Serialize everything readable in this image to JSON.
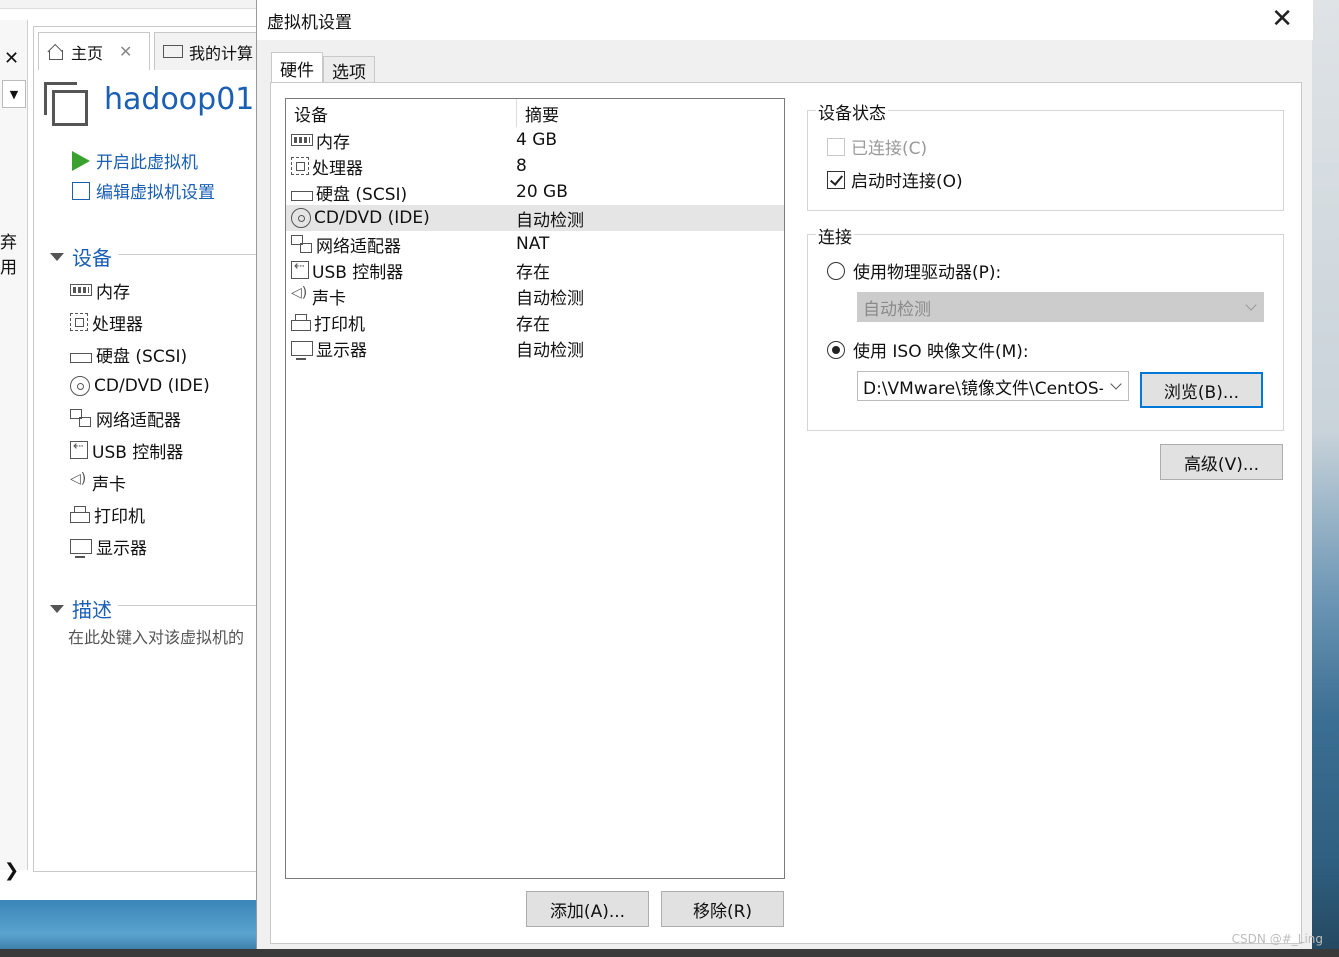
{
  "background_app": {
    "tabs": [
      {
        "label": "主页",
        "icon": "home-icon"
      },
      {
        "label": "我的计算",
        "icon": "computer-icon"
      }
    ],
    "vm_name": "hadoop01",
    "actions": {
      "power_on": "开启此虚拟机",
      "edit_settings": "编辑虚拟机设置"
    },
    "devices_section": "设备",
    "devices": [
      "内存",
      "处理器",
      "硬盘 (SCSI)",
      "CD/DVD (IDE)",
      "网络适配器",
      "USB 控制器",
      "声卡",
      "打印机",
      "显示器"
    ],
    "description_section": "描述",
    "description_placeholder": "在此处键入对该虚拟机的",
    "side_text": "弃用",
    "close_glyph": "✕",
    "chevron_glyph": "❯"
  },
  "dialog": {
    "title": "虚拟机设置",
    "close_glyph": "✕",
    "tabs": [
      {
        "label": "硬件",
        "active": true
      },
      {
        "label": "选项",
        "active": false
      }
    ],
    "device_table": {
      "headers": [
        "设备",
        "摘要"
      ],
      "rows": [
        {
          "device": "内存",
          "summary": "4 GB",
          "icon": "memory-icon"
        },
        {
          "device": "处理器",
          "summary": "8",
          "icon": "processor-icon"
        },
        {
          "device": "硬盘 (SCSI)",
          "summary": "20 GB",
          "icon": "hard-disk-icon"
        },
        {
          "device": "CD/DVD (IDE)",
          "summary": "自动检测",
          "icon": "cd-dvd-icon",
          "selected": true
        },
        {
          "device": "网络适配器",
          "summary": "NAT",
          "icon": "network-adapter-icon"
        },
        {
          "device": "USB 控制器",
          "summary": "存在",
          "icon": "usb-icon"
        },
        {
          "device": "声卡",
          "summary": "自动检测",
          "icon": "sound-card-icon"
        },
        {
          "device": "打印机",
          "summary": "存在",
          "icon": "printer-icon"
        },
        {
          "device": "显示器",
          "summary": "自动检测",
          "icon": "monitor-icon"
        }
      ]
    },
    "buttons": {
      "add": "添加(A)...",
      "remove": "移除(R)",
      "browse": "浏览(B)...",
      "advanced": "高级(V)..."
    },
    "device_status": {
      "label": "设备状态",
      "connected": {
        "label": "已连接(C)",
        "checked": false,
        "disabled": true
      },
      "connect_at_power_on": {
        "label": "启动时连接(O)",
        "checked": true
      }
    },
    "connection": {
      "label": "连接",
      "physical_drive": {
        "label": "使用物理驱动器(P):",
        "selected": false,
        "value": "自动检测"
      },
      "iso_image": {
        "label": "使用 ISO 映像文件(M):",
        "selected": true,
        "value": "D:\\VMware\\镜像文件\\CentOS-"
      }
    }
  },
  "watermark": "CSDN @#_Ling",
  "colors": {
    "accent": "#1a5fb4",
    "focus": "#0078d7",
    "play": "#3aa12e"
  }
}
